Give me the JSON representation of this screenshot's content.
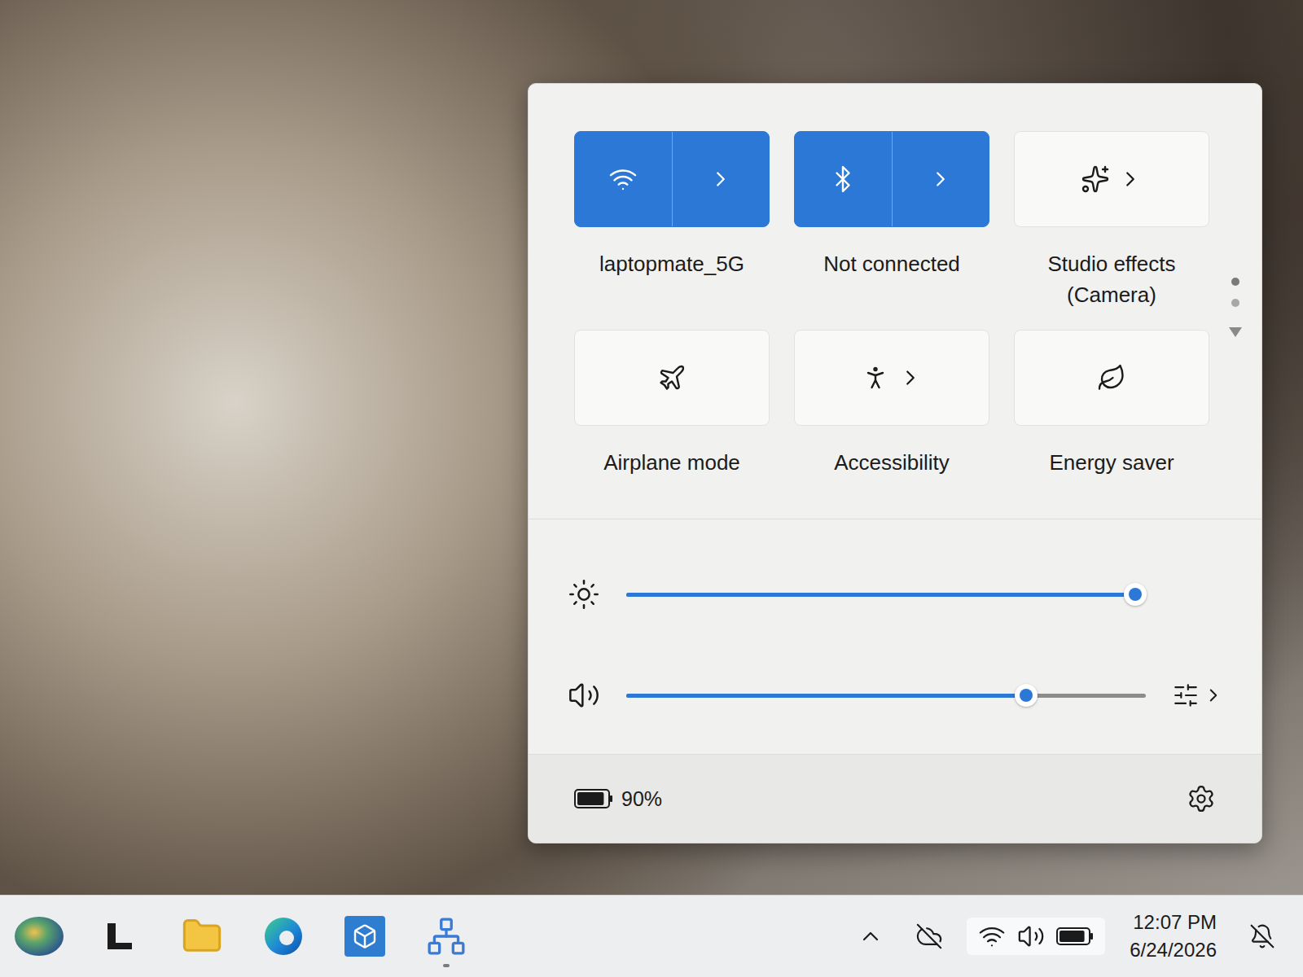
{
  "quick_settings": {
    "tiles": [
      {
        "kind": "wifi",
        "label": "laptopmate_5G",
        "on": true,
        "split": true,
        "expandable": true
      },
      {
        "kind": "bluetooth",
        "label": "Not connected",
        "on": true,
        "split": true,
        "expandable": true
      },
      {
        "kind": "studio-effects",
        "label": "Studio effects (Camera)",
        "on": false,
        "split": false,
        "expandable": true
      },
      {
        "kind": "airplane",
        "label": "Airplane mode",
        "on": false,
        "split": false,
        "expandable": false
      },
      {
        "kind": "accessibility",
        "label": "Accessibility",
        "on": false,
        "split": false,
        "expandable": true
      },
      {
        "kind": "energy-saver",
        "label": "Energy saver",
        "on": false,
        "split": false,
        "expandable": false
      }
    ],
    "pages": [
      {
        "selected": true
      },
      {
        "selected": false
      }
    ],
    "sliders": [
      {
        "kind": "brightness",
        "level": 0.98,
        "expandable": false
      },
      {
        "kind": "volume",
        "level": 0.77,
        "expandable": true
      }
    ],
    "battery": {
      "reading": "90%",
      "level": 0.9
    }
  },
  "taskbar": {
    "apps": [
      {
        "kind": "weather",
        "running": false
      },
      {
        "kind": "terminal",
        "running": false
      },
      {
        "kind": "file-explorer",
        "running": false
      },
      {
        "kind": "edge",
        "running": false
      },
      {
        "kind": "cube-app",
        "running": false
      },
      {
        "kind": "network-app",
        "running": true
      }
    ],
    "tray": {
      "onedrive_paused": true,
      "quick_settings_open": true,
      "do_not_disturb": true
    },
    "clock": {
      "time": "12:07 PM",
      "date": "6/24/2026"
    }
  }
}
